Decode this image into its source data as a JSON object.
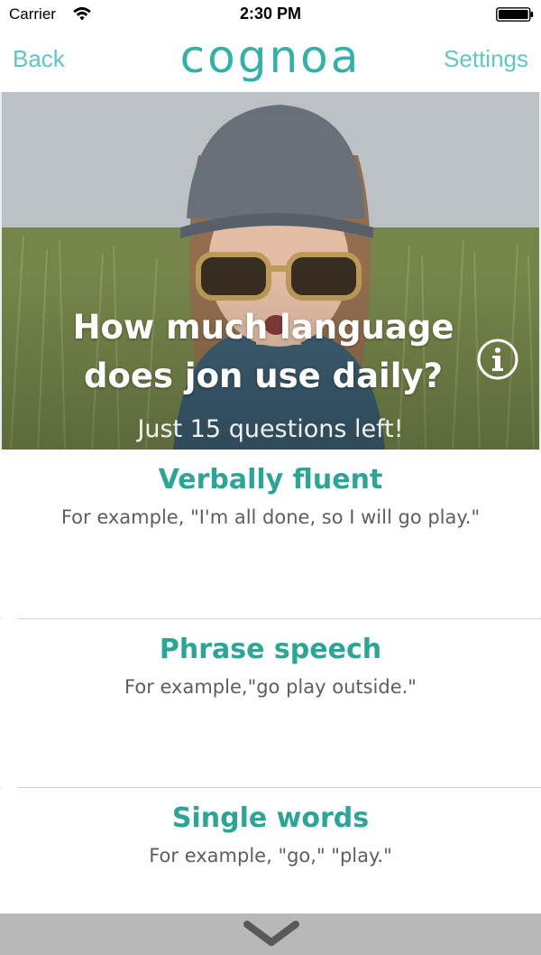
{
  "status_bar": {
    "carrier": "Carrier",
    "time": "2:30 PM",
    "wifi_icon": "wifi-icon",
    "battery_icon": "battery-icon"
  },
  "nav": {
    "back_label": "Back",
    "logo_text": "cognoa",
    "settings_label": "Settings"
  },
  "hero": {
    "question": "How much language does jon use daily?",
    "subtitle": "Just 15 questions left!",
    "info_icon": "info-icon"
  },
  "options": [
    {
      "title": "Verbally fluent",
      "example": "For example, \"I'm all done, so I will go play.\""
    },
    {
      "title": "Phrase speech",
      "example": "For example,\"go play outside.\""
    },
    {
      "title": "Single words",
      "example": "For example, \"go,\"  \"play.\""
    }
  ],
  "bottom_bar": {
    "next_icon": "chevron-down-icon"
  },
  "colors": {
    "accent": "#5ec8c0",
    "option_title": "#2aa596",
    "logo": "#2fb3a8",
    "bottom_bar": "#b8b8b8"
  }
}
